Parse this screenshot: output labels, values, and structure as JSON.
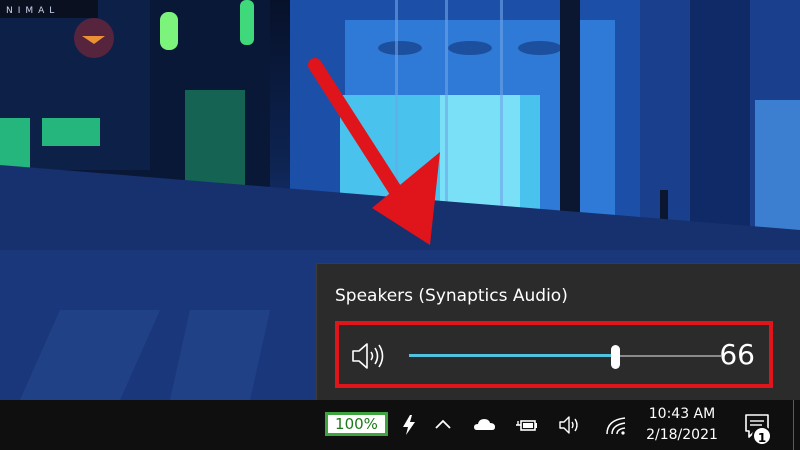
{
  "wallpaper": {
    "sign_text": "NIMAL"
  },
  "volume_flyout": {
    "device_name": "Speakers (Synaptics Audio)",
    "volume": 66,
    "volume_label": "66",
    "volume_fraction": 0.66,
    "accent_color": "#4fc3e0",
    "highlight_color": "#e0141b"
  },
  "taskbar": {
    "battery_percent": "100%",
    "tray_icons": [
      "charging-icon",
      "chevron-up-icon",
      "onedrive-cloud-icon",
      "power-plug-icon",
      "speaker-icon",
      "wifi-icon"
    ],
    "time": "10:43 AM",
    "date": "2/18/2021",
    "notification_count": "1"
  }
}
